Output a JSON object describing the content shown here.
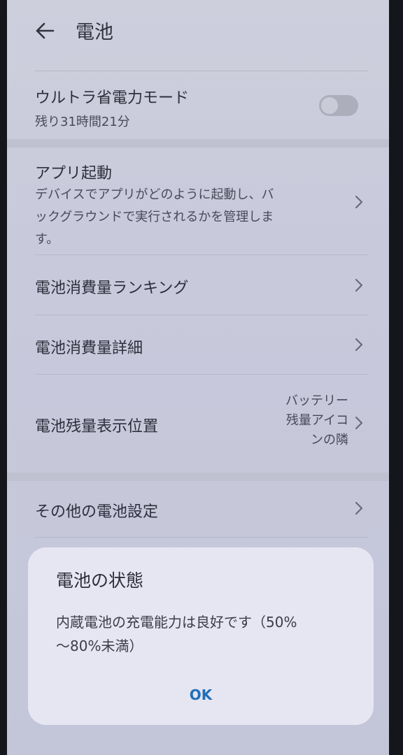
{
  "header": {
    "title": "電池",
    "back_icon": "arrow-left-icon"
  },
  "ultra_power_mode": {
    "title": "ウルトラ省電力モード",
    "remaining": "残り31時間21分",
    "toggle_on": false
  },
  "app_launch": {
    "title": "アプリ起動",
    "description_line1": "デバイスでアプリがどのように起動し、バ",
    "description_line2": "ックグラウンドで実行されるかを管理しま",
    "description_line3": "す。"
  },
  "menu_items": {
    "ranking": "電池消費量ランキング",
    "details": "電池消費量詳細",
    "display_position": "電池残量表示位置",
    "display_position_value_line1": "バッテリー",
    "display_position_value_line2": "残量アイコ",
    "display_position_value_line3": "ンの隣",
    "other_settings": "その他の電池設定"
  },
  "dialog": {
    "title": "電池の状態",
    "body_line1": "内蔵電池の充電能力は良好です（50%",
    "body_line2": "～80%未満）",
    "ok_label": "OK"
  },
  "colors": {
    "accent": "#1f6fb8",
    "background": "#d8daea"
  }
}
